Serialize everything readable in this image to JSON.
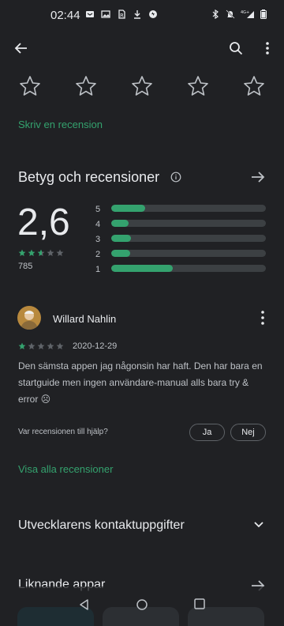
{
  "status_bar": {
    "time": "02:44",
    "network_label": "4G+",
    "icons": [
      "notification-icon",
      "photo-icon",
      "app-icon",
      "download-icon",
      "sync-icon",
      "bluetooth-icon",
      "mute-icon",
      "signal-icon",
      "battery-icon"
    ]
  },
  "app_bar": {
    "icons": [
      "arrow-back-icon",
      "search-icon",
      "more-vert-icon"
    ]
  },
  "rate_app": {
    "star_count": 5,
    "write_review_label": "Skriv en recension"
  },
  "ratings": {
    "title": "Betyg och recensioner",
    "average": "2,6",
    "review_count": "785",
    "average_value": 2.6,
    "distribution": [
      {
        "stars": "5",
        "fraction": 0.22
      },
      {
        "stars": "4",
        "fraction": 0.11
      },
      {
        "stars": "3",
        "fraction": 0.13
      },
      {
        "stars": "2",
        "fraction": 0.12
      },
      {
        "stars": "1",
        "fraction": 0.4
      }
    ]
  },
  "review": {
    "author": "Willard Nahlin",
    "rating": 1,
    "date": "2020-12-29",
    "text": "Den sämsta appen jag någonsin har haft. Den har bara en startguide men ingen användare-manual alls bara try & error ☹",
    "helpful_question": "Var recensionen till hjälp?",
    "yes_label": "Ja",
    "no_label": "Nej"
  },
  "see_all_reviews_label": "Visa alla recensioner",
  "developer_contact_label": "Utvecklarens kontaktuppgifter",
  "similar_apps_label": "Liknande appar",
  "colors": {
    "background": "#202124",
    "accent": "#34a26e",
    "track": "#3c4043",
    "text_primary": "#e8eaed",
    "text_secondary": "#bdc1c6"
  }
}
